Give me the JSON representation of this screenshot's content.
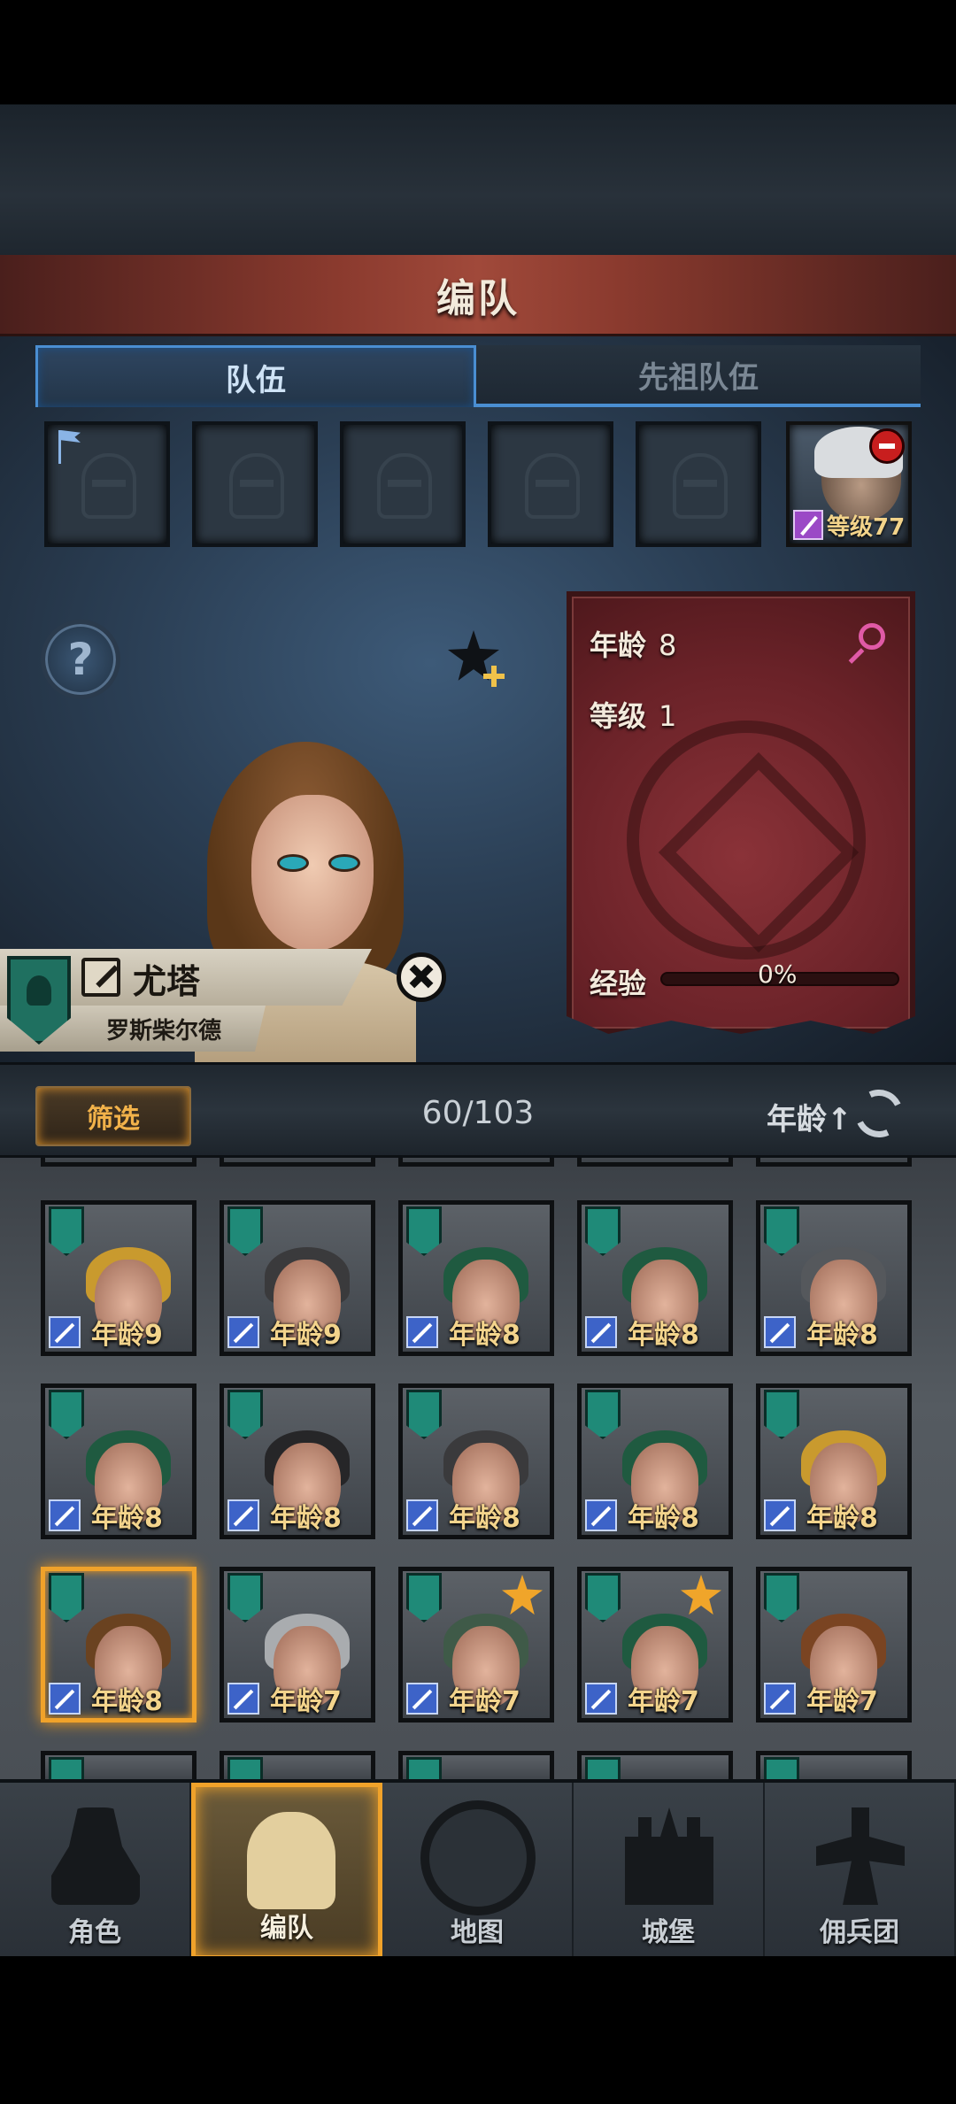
{
  "header": {
    "title": "编队"
  },
  "tabs": [
    {
      "label": "队伍",
      "active": true
    },
    {
      "label": "先祖队伍",
      "active": false
    }
  ],
  "team_slots": {
    "empty_count": 5,
    "hero": {
      "level_label": "等级77"
    }
  },
  "character": {
    "name": "尤塔",
    "house": "罗斯柴尔德",
    "age_label": "年龄",
    "age": "8",
    "level_label": "等级",
    "level": "1",
    "exp_label": "经验",
    "exp_percent": "0%",
    "exp_fraction": 0
  },
  "filter_bar": {
    "filter_label": "筛选",
    "count": "60/103",
    "sort_label": "年龄↑"
  },
  "roster": [
    {
      "age": "年龄9",
      "hair": "#c99a2e",
      "starred": false,
      "selected": false
    },
    {
      "age": "年龄9",
      "hair": "#3a3a3c",
      "starred": false,
      "selected": false
    },
    {
      "age": "年龄8",
      "hair": "#1f5a40",
      "starred": false,
      "selected": false
    },
    {
      "age": "年龄8",
      "hair": "#1f5a40",
      "starred": false,
      "selected": false
    },
    {
      "age": "年龄8",
      "hair": "#55585c",
      "starred": false,
      "selected": false
    },
    {
      "age": "年龄8",
      "hair": "#1f5a40",
      "starred": false,
      "selected": false
    },
    {
      "age": "年龄8",
      "hair": "#262628",
      "starred": false,
      "selected": false
    },
    {
      "age": "年龄8",
      "hair": "#3a3a3c",
      "starred": false,
      "selected": false
    },
    {
      "age": "年龄8",
      "hair": "#1f5a40",
      "starred": false,
      "selected": false
    },
    {
      "age": "年龄8",
      "hair": "#c99a2e",
      "starred": false,
      "selected": false
    },
    {
      "age": "年龄8",
      "hair": "#6a4220",
      "starred": false,
      "selected": true
    },
    {
      "age": "年龄7",
      "hair": "#a9acaf",
      "starred": false,
      "selected": false
    },
    {
      "age": "年龄7",
      "hair": "#3f5a48",
      "starred": true,
      "selected": false
    },
    {
      "age": "年龄7",
      "hair": "#1f5a40",
      "starred": true,
      "selected": false
    },
    {
      "age": "年龄7",
      "hair": "#7a4422",
      "starred": false,
      "selected": false
    }
  ],
  "nav": [
    {
      "label": "角色",
      "icon": "knight-icon",
      "active": false
    },
    {
      "label": "编队",
      "icon": "helmet-icon",
      "active": true
    },
    {
      "label": "地图",
      "icon": "compass-icon",
      "active": false
    },
    {
      "label": "城堡",
      "icon": "castle-icon",
      "active": false
    },
    {
      "label": "佣兵团",
      "icon": "mercenary-icon",
      "active": false
    }
  ],
  "colors": {
    "accent_blue": "#4a8ed2",
    "selection_orange": "#f0a22a",
    "banner_red": "#a0493a",
    "female_pink": "#e05aa6"
  }
}
